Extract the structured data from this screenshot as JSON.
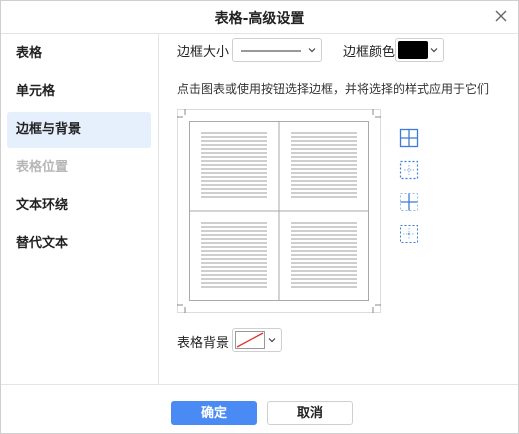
{
  "dialog": {
    "title": "表格-高级设置"
  },
  "sidebar": {
    "items": [
      {
        "label": "表格",
        "state": "normal"
      },
      {
        "label": "单元格",
        "state": "normal"
      },
      {
        "label": "边框与背景",
        "state": "active"
      },
      {
        "label": "表格位置",
        "state": "disabled"
      },
      {
        "label": "文本环绕",
        "state": "normal"
      },
      {
        "label": "替代文本",
        "state": "normal"
      }
    ]
  },
  "border": {
    "size_label": "边框大小",
    "color_label": "边框颜色",
    "color_value": "#000000",
    "hint": "点击图表或使用按钮选择边框，并将选择的样式应用于它们"
  },
  "background": {
    "label": "表格背景"
  },
  "footer": {
    "ok": "确定",
    "cancel": "取消"
  },
  "colors": {
    "accent": "#4a8af4",
    "active_nav_bg": "#e6f0fd",
    "icon_blue": "#3d7bd9"
  }
}
